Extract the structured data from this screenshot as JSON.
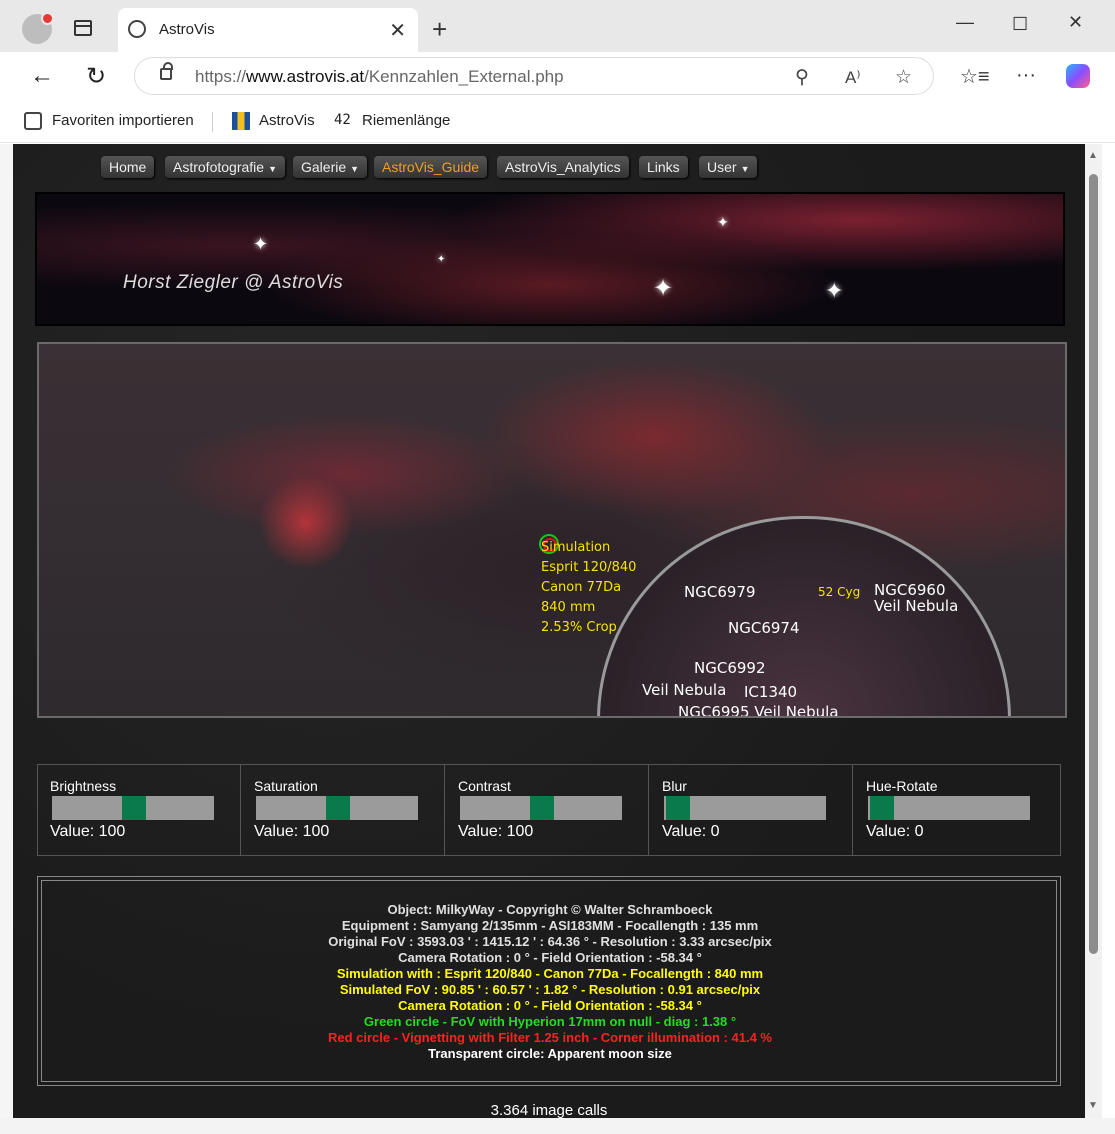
{
  "browser": {
    "tab_title": "AstroVis",
    "url_prefix": "https://",
    "url_domain": "www.astrovis.at",
    "url_path": "/Kennzahlen_External.php"
  },
  "favorites": [
    {
      "label": "Favoriten importieren"
    },
    {
      "label": "AstroVis"
    },
    {
      "label": "Riemenlänge"
    }
  ],
  "nav": [
    {
      "label": "Home",
      "dropdown": false,
      "active": false
    },
    {
      "label": "Astrofotografie",
      "dropdown": true,
      "active": false
    },
    {
      "label": "Galerie",
      "dropdown": true,
      "active": false
    },
    {
      "label": "AstroVis_Guide",
      "dropdown": false,
      "active": true
    },
    {
      "label": "AstroVis_Analytics",
      "dropdown": false,
      "active": false
    },
    {
      "label": "Links",
      "dropdown": false,
      "active": false
    },
    {
      "label": "User",
      "dropdown": true,
      "active": false
    }
  ],
  "banner": {
    "signature": "Horst Ziegler @ AstroVis"
  },
  "simulation": {
    "lines": [
      "Simulation",
      "Esprit 120/840",
      "Canon 77Da",
      "840 mm",
      "2.53% Crop"
    ]
  },
  "inset_labels": [
    {
      "text": "NGC6979",
      "color": "white"
    },
    {
      "text": "52 Cyg",
      "color": "yellow"
    },
    {
      "text": "NGC6960",
      "color": "white"
    },
    {
      "text": "Veil Nebula",
      "color": "white"
    },
    {
      "text": "NGC6974",
      "color": "white"
    },
    {
      "text": "NGC6992",
      "color": "white"
    },
    {
      "text": "Veil Nebula",
      "color": "white"
    },
    {
      "text": "IC1340",
      "color": "white"
    },
    {
      "text": "NGC6995 Veil Nebula",
      "color": "white"
    }
  ],
  "sliders": [
    {
      "label": "Brightness",
      "value_text": "Value: 100",
      "level": 0.5
    },
    {
      "label": "Saturation",
      "value_text": "Value: 100",
      "level": 0.5
    },
    {
      "label": "Contrast",
      "value_text": "Value: 100",
      "level": 0.5
    },
    {
      "label": "Blur",
      "value_text": "Value: 0",
      "level": 0.0
    },
    {
      "label": "Hue-Rotate",
      "value_text": "Value: 0",
      "level": 0.0
    }
  ],
  "info_lines": [
    {
      "text": "Object: MilkyWay  -  Copyright © Walter Schramboeck",
      "color": "#e0e0e0"
    },
    {
      "text": "Equipment : Samyang 2/135mm  -  ASI183MM  -  Focallength : 135 mm",
      "color": "#e0e0e0"
    },
    {
      "text": "Original FoV : 3593.03 ' : 1415.12 ' : 64.36 °  -  Resolution : 3.33 arcsec/pix",
      "color": "#e0e0e0"
    },
    {
      "text": "Camera Rotation : 0 °  -  Field Orientation : -58.34 °",
      "color": "#e0e0e0"
    },
    {
      "text": "Simulation with : Esprit 120/840  -  Canon 77Da  -  Focallength : 840 mm",
      "color": "#ffff00"
    },
    {
      "text": "Simulated FoV : 90.85 ' : 60.57 ' : 1.82 °  -  Resolution : 0.91 arcsec/pix",
      "color": "#ffff00"
    },
    {
      "text": "Camera Rotation : 0 °  -  Field Orientation : -58.34 °",
      "color": "#ffff00"
    },
    {
      "text": "Green circle  -  FoV with Hyperion 17mm on null  -  diag : 1.38 °",
      "color": "#22dd22"
    },
    {
      "text": "Red circle  -  Vignetting with Filter 1.25 inch  -  Corner illumination : 41.4 %",
      "color": "#ff2020"
    },
    {
      "text": "Transparent circle: Apparent moon size",
      "color": "#ffffff"
    }
  ],
  "image_calls": "3.364 image calls"
}
